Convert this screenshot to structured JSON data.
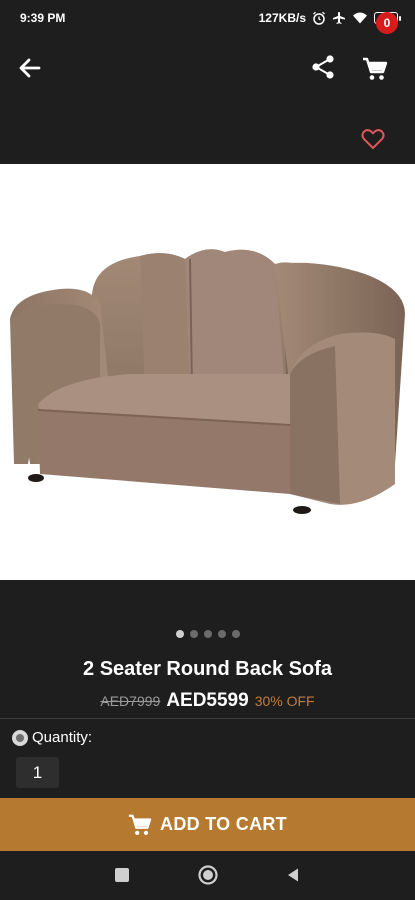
{
  "status_bar": {
    "time": "9:39 PM",
    "network_speed": "127KB/s",
    "battery": "42",
    "icons": [
      "alarm-icon",
      "airplane-icon",
      "wifi-icon",
      "battery-icon"
    ]
  },
  "app_bar": {
    "back_icon": "back-arrow-icon",
    "share_icon": "share-icon",
    "cart_icon": "cart-icon",
    "cart_count": "0"
  },
  "wishlist": {
    "icon": "heart-outline-icon"
  },
  "product": {
    "image": "sofa-image",
    "carousel_dots": 5,
    "active_dot": 1,
    "title": "2 Seater Round Back Sofa",
    "old_price": "AED7999",
    "price": "AED5599",
    "discount": "30% OFF"
  },
  "quantity": {
    "label": "Quantity:",
    "value": "1"
  },
  "add_to_cart": {
    "label": "ADD TO CART",
    "icon": "cart-icon"
  },
  "colors": {
    "background": "#1e1e1e",
    "accent": "#b5792f",
    "badge": "#d81b1b",
    "heart": "#e0565b",
    "discount": "#c07d38"
  },
  "nav_bar": {
    "icons": [
      "recent-apps-icon",
      "home-icon",
      "back-triangle-icon"
    ]
  }
}
